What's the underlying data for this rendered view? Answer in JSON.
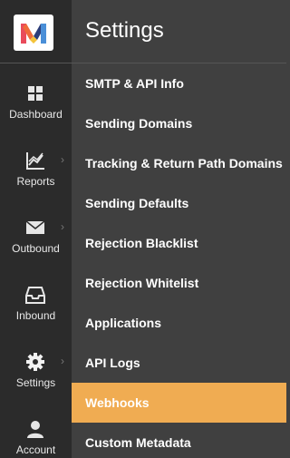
{
  "rail": {
    "logo": "mandrill-logo",
    "items": [
      {
        "label": "Dashboard",
        "icon": "grid-icon",
        "has_submenu": false
      },
      {
        "label": "Reports",
        "icon": "chart-icon",
        "has_submenu": true
      },
      {
        "label": "Outbound",
        "icon": "envelope-icon",
        "has_submenu": true
      },
      {
        "label": "Inbound",
        "icon": "inbox-icon",
        "has_submenu": false
      },
      {
        "label": "Settings",
        "icon": "gear-icon",
        "has_submenu": true
      },
      {
        "label": "Account",
        "icon": "user-icon",
        "has_submenu": false
      }
    ]
  },
  "panel": {
    "title": "Settings",
    "items": [
      {
        "label": "SMTP & API Info"
      },
      {
        "label": "Sending Domains"
      },
      {
        "label": "Tracking & Return Path Domains"
      },
      {
        "label": "Sending Defaults"
      },
      {
        "label": "Rejection Blacklist"
      },
      {
        "label": "Rejection Whitelist"
      },
      {
        "label": "Applications"
      },
      {
        "label": "API Logs"
      },
      {
        "label": "Webhooks",
        "active": true
      },
      {
        "label": "Custom Metadata"
      }
    ]
  },
  "colors": {
    "rail_bg": "#2b2b2b",
    "panel_bg": "#404040",
    "active_bg": "#f0ac52",
    "text": "#ffffff"
  }
}
